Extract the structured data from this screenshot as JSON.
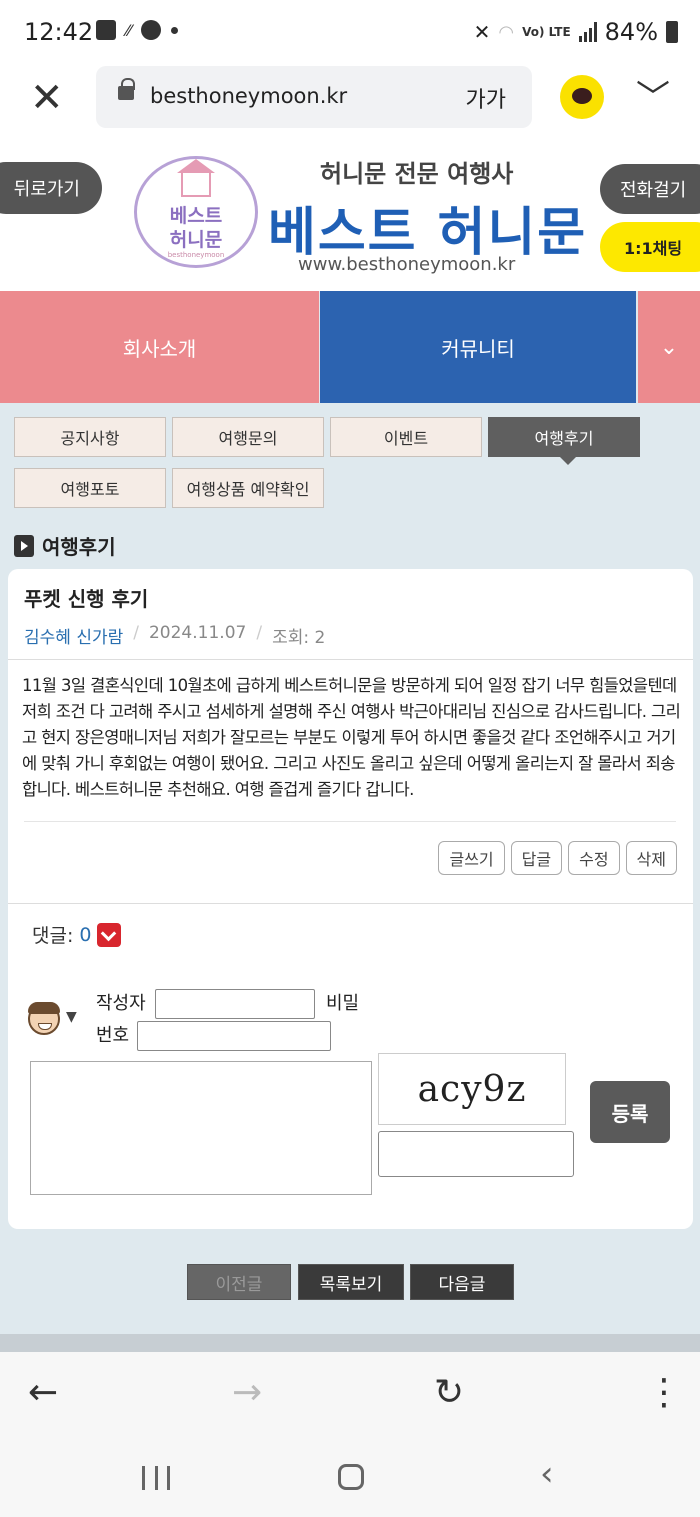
{
  "status_bar": {
    "time": "12:42",
    "lte_label": "Vo) LTE",
    "battery": "84%"
  },
  "browser": {
    "url": "besthoneymoon.kr",
    "text_size_label": "가가"
  },
  "site_header": {
    "back_label": "뒤로가기",
    "call_label": "전화걸기",
    "chat_label": "1:1채팅",
    "logo_line1": "베스트",
    "logo_line2": "허니문",
    "logo_small": "besthoneymoon",
    "subtitle": "허니문 전문 여행사",
    "title": "베스트 허니문",
    "site_url": "www.besthoneymoon.kr"
  },
  "main_nav": {
    "items": [
      {
        "label": "회사소개"
      },
      {
        "label": "커뮤니티"
      }
    ]
  },
  "sub_tabs": [
    {
      "label": "공지사항"
    },
    {
      "label": "여행문의"
    },
    {
      "label": "이벤트"
    },
    {
      "label": "여행후기",
      "active": true
    },
    {
      "label": "여행포토"
    },
    {
      "label": "여행상품 예약확인"
    }
  ],
  "section_title": "여행후기",
  "post": {
    "title": "푸켓 신행 후기",
    "author": "김수혜 신가람",
    "date": "2024.11.07",
    "views": "조회: 2",
    "body": "11월 3일 결혼식인데 10월초에 급하게 베스트허니문을 방문하게 되어 일정 잡기 너무 힘들었을텐데 저희 조건 다 고려해 주시고 섬세하게 설명해 주신 여행사 박근아대리님 진심으로 감사드립니다. 그리고 현지 장은영매니저님 저희가 잘모르는 부분도 이렇게 투어 하시면 좋을것 같다 조언해주시고 거기에 맞춰 가니 후회없는 여행이 됐어요. 그리고 사진도 올리고 싶은데 어떻게 올리는지 잘 몰라서 죄송합니다. 베스트허니문 추천해요. 여행 즐겁게 즐기다 갑니다."
  },
  "post_actions": {
    "write": "글쓰기",
    "reply": "답글",
    "edit": "수정",
    "delete": "삭제"
  },
  "comments": {
    "label": "댓글:",
    "count": "0",
    "author_label": "작성자",
    "password_label_1": "비밀",
    "password_label_2": "번호",
    "captcha_text": "acy9z",
    "submit_label": "등록"
  },
  "pager": {
    "prev": "이전글",
    "list": "목록보기",
    "next": "다음글"
  },
  "colors": {
    "nav_pink": "#ec8a8e",
    "nav_blue": "#2c63b0",
    "chat_yellow": "#fde800",
    "link_blue": "#2a6fb0"
  }
}
